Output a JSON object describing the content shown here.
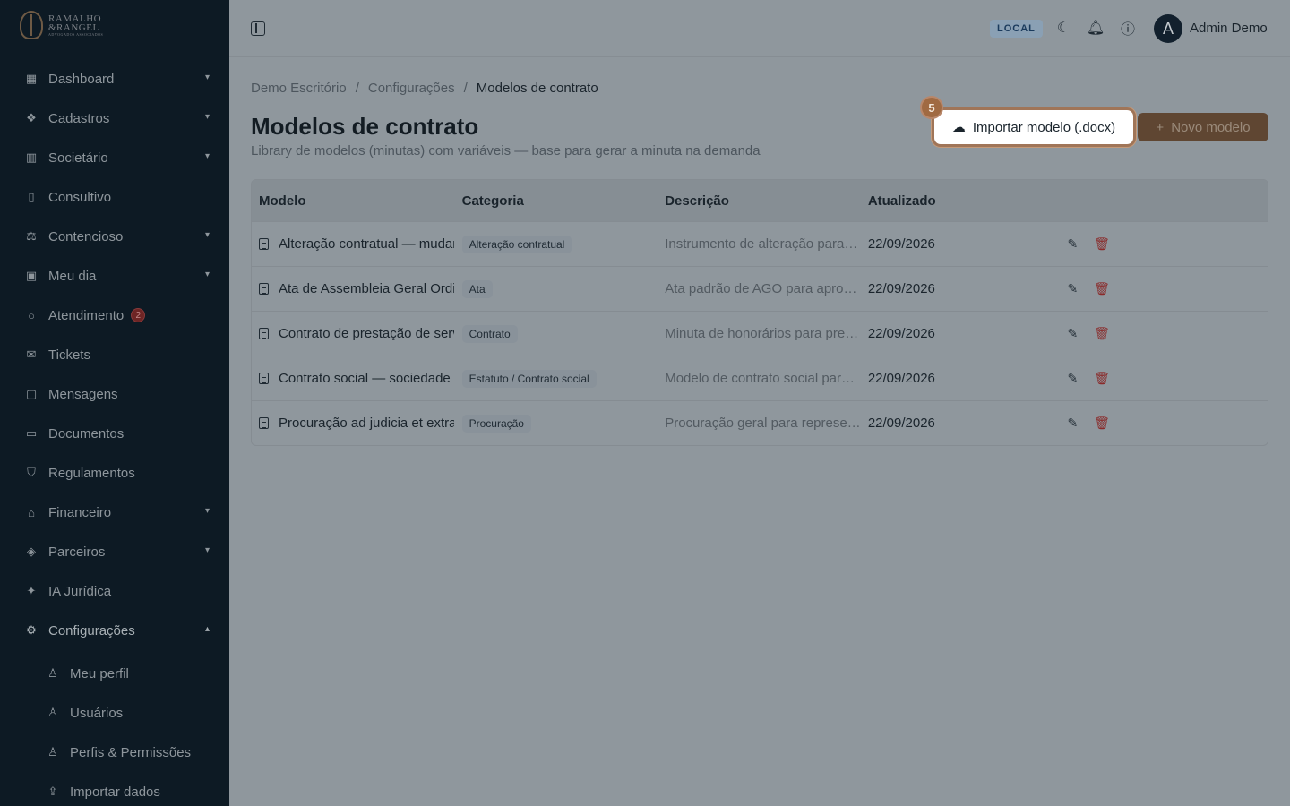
{
  "brand": {
    "line1": "RAMALHO",
    "line2": "&RANGEL",
    "tagline": "ADVOGADOS ASSOCIADOS"
  },
  "sidebar": {
    "items": [
      {
        "label": "Dashboard",
        "icon": "grid-icon",
        "chevron": "down"
      },
      {
        "label": "Cadastros",
        "icon": "boxes-icon",
        "chevron": "down"
      },
      {
        "label": "Societário",
        "icon": "building-icon",
        "chevron": "down"
      },
      {
        "label": "Consultivo",
        "icon": "book-icon",
        "chevron": ""
      },
      {
        "label": "Contencioso",
        "icon": "scale-icon",
        "chevron": "down"
      },
      {
        "label": "Meu dia",
        "icon": "calendar-icon",
        "chevron": "down"
      },
      {
        "label": "Atendimento",
        "icon": "chat-icon",
        "chevron": "",
        "badge": "2"
      },
      {
        "label": "Tickets",
        "icon": "ticket-icon",
        "chevron": ""
      },
      {
        "label": "Mensagens",
        "icon": "message-icon",
        "chevron": ""
      },
      {
        "label": "Documentos",
        "icon": "folder-icon",
        "chevron": ""
      },
      {
        "label": "Regulamentos",
        "icon": "shield-icon",
        "chevron": ""
      },
      {
        "label": "Financeiro",
        "icon": "bank-icon",
        "chevron": "down"
      },
      {
        "label": "Parceiros",
        "icon": "handshake-icon",
        "chevron": "down"
      },
      {
        "label": "IA Jurídica",
        "icon": "sparkle-icon",
        "chevron": ""
      },
      {
        "label": "Configurações",
        "icon": "gear-icon",
        "chevron": "up"
      }
    ],
    "subitems": [
      {
        "label": "Meu perfil",
        "icon": "user-icon"
      },
      {
        "label": "Usuários",
        "icon": "users-icon"
      },
      {
        "label": "Perfis & Permissões",
        "icon": "user-check-icon"
      },
      {
        "label": "Importar dados",
        "icon": "upload-icon"
      }
    ]
  },
  "header": {
    "env": "LOCAL",
    "user": "Admin Demo",
    "avatar_initial": "A"
  },
  "breadcrumb": [
    "Demo Escritório",
    "Configurações",
    "Modelos de contrato"
  ],
  "page": {
    "title": "Modelos de contrato",
    "subtitle": "Library de modelos (minutas) com variáveis — base para gerar a minuta na demanda",
    "import_label": "Importar modelo (.docx)",
    "new_label": "Novo modelo",
    "step": "5"
  },
  "table": {
    "headers": [
      "Modelo",
      "Categoria",
      "Descrição",
      "Atualizado"
    ],
    "rows": [
      {
        "name": "Alteração contratual — mudança de endereço",
        "category": "Alteração contratual",
        "description": "Instrumento de alteração para mudança",
        "updated": "22/09/2026"
      },
      {
        "name": "Ata de Assembleia Geral Ordinária",
        "category": "Ata",
        "description": "Ata padrão de AGO para aprovação",
        "updated": "22/09/2026"
      },
      {
        "name": "Contrato de prestação de serviços",
        "category": "Contrato",
        "description": "Minuta de honorários para prestação",
        "updated": "22/09/2026"
      },
      {
        "name": "Contrato social — sociedade limitada",
        "category": "Estatuto / Contrato social",
        "description": "Modelo de contrato social para LTDA",
        "updated": "22/09/2026"
      },
      {
        "name": "Procuração ad judicia et extra",
        "category": "Procuração",
        "description": "Procuração geral para representação",
        "updated": "22/09/2026"
      }
    ]
  }
}
